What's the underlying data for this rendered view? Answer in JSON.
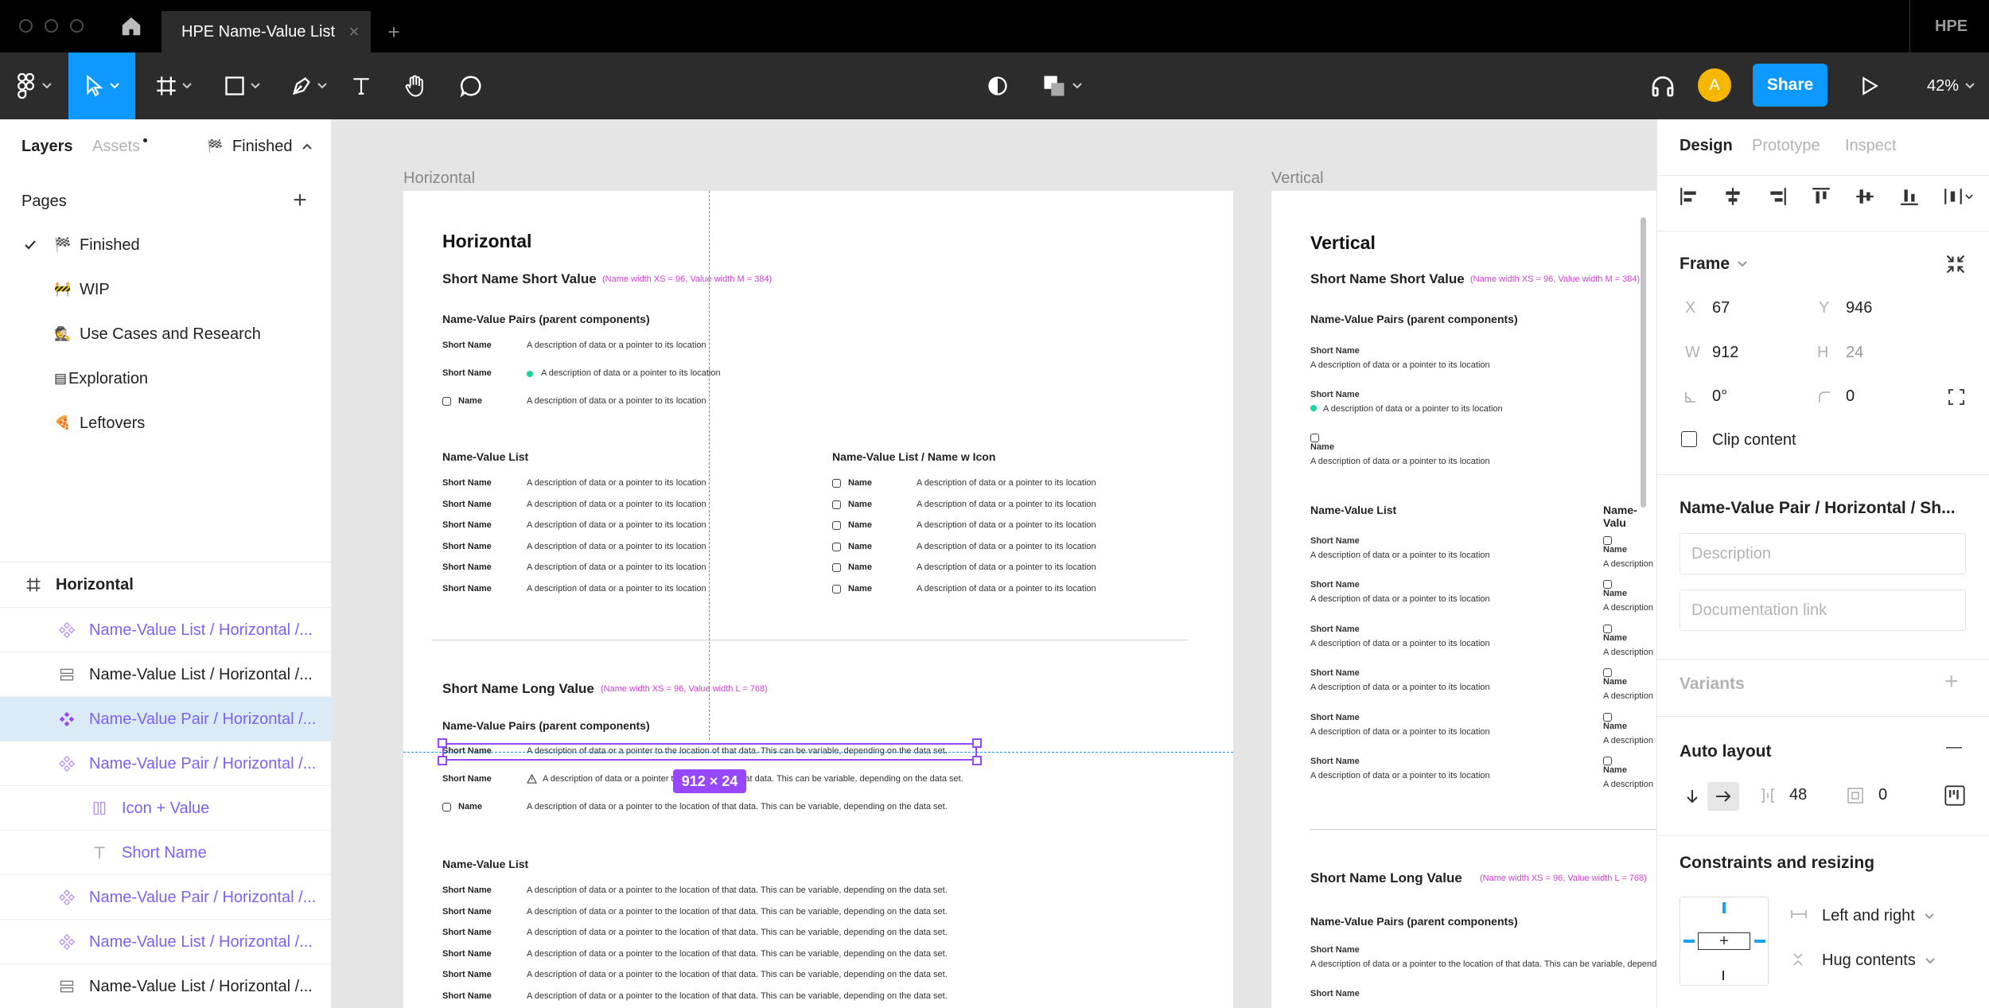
{
  "window": {
    "tab_title": "HPE Name-Value List",
    "tab_close": "×",
    "new_tab": "+",
    "brand": "HPE"
  },
  "toolbar": {
    "avatar": "A",
    "share_label": "Share",
    "zoom": "42%"
  },
  "left_panel": {
    "tabs": [
      "Layers",
      "Assets"
    ],
    "current_page_badge": "Finished",
    "pages_heading": "Pages",
    "add": "+",
    "pages": [
      {
        "label": "Finished",
        "emoji": "🏁",
        "active": true
      },
      {
        "label": "WIP",
        "emoji": "🚧",
        "active": false
      },
      {
        "label": "Use Cases and Research",
        "emoji": "🕵",
        "active": false
      },
      {
        "label": "Exploration",
        "emoji": "▤",
        "active": false
      },
      {
        "label": "Leftovers",
        "emoji": "🍕",
        "active": false
      }
    ],
    "layers": [
      {
        "label": "Horizontal",
        "icon": "frame-icon",
        "indent": 0,
        "purple": false,
        "selected": false,
        "bold": true
      },
      {
        "label": "Name-Value List / Horizontal /...",
        "icon": "component-instance-icon",
        "indent": 1,
        "purple": true,
        "selected": false
      },
      {
        "label": "Name-Value List / Horizontal /...",
        "icon": "auto-layout-vertical-icon",
        "indent": 1,
        "purple": false,
        "selected": false
      },
      {
        "label": "Name-Value Pair / Horizontal /...",
        "icon": "component-icon",
        "indent": 1,
        "purple": true,
        "selected": true
      },
      {
        "label": "Name-Value Pair / Horizontal /...",
        "icon": "component-instance-icon",
        "indent": 1,
        "purple": true,
        "selected": false
      },
      {
        "label": "Icon + Value",
        "icon": "auto-layout-horizontal-icon",
        "indent": 2,
        "purple": true,
        "selected": false
      },
      {
        "label": "Short Name",
        "icon": "text-icon",
        "indent": 2,
        "purple": true,
        "selected": false
      },
      {
        "label": "Name-Value Pair / Horizontal /...",
        "icon": "component-instance-icon",
        "indent": 1,
        "purple": true,
        "selected": false
      },
      {
        "label": "Name-Value List / Horizontal /...",
        "icon": "component-instance-icon",
        "indent": 1,
        "purple": true,
        "selected": false
      },
      {
        "label": "Name-Value List / Horizontal /...",
        "icon": "auto-layout-vertical-icon",
        "indent": 1,
        "purple": false,
        "selected": false
      }
    ]
  },
  "right_panel": {
    "tabs": [
      "Design",
      "Prototype",
      "Inspect"
    ],
    "frame_label": "Frame",
    "x_label": "X",
    "x": "67",
    "y_label": "Y",
    "y": "946",
    "w_label": "W",
    "w": "912",
    "h_label": "H",
    "h": "24",
    "rotation": "0°",
    "radius": "0",
    "clip_content": "Clip content",
    "component_name": "Name-Value Pair / Horizontal / Sh...",
    "description_placeholder": "Description",
    "doc_link_placeholder": "Documentation link",
    "variants": "Variants",
    "variants_add": "+",
    "auto_layout": "Auto layout",
    "auto_layout_remove": "—",
    "spacing": "48",
    "padding": "0",
    "constraints": "Constraints and resizing",
    "horizontal_constraint": "Left and right",
    "vertical_resizing": "Hug contents"
  },
  "canvas": {
    "frame_labels": [
      "Horizontal",
      "Vertical"
    ],
    "size_badge": "912 × 24",
    "horizontal": {
      "title": "Horizontal",
      "section1": "Short Name Short Value",
      "section1_note": "(Name width XS = 96, Value width M = 384)",
      "pairs_heading": "Name-Value Pairs (parent components)",
      "pairs": [
        {
          "name": "Short Name",
          "value": "A description of data or a pointer to its location"
        },
        {
          "name": "Short Name",
          "value": "A description of data or a pointer to its location"
        },
        {
          "name": "Name",
          "value": "A description of data or a pointer to its location"
        }
      ],
      "list_heading": "Name-Value List",
      "list_rows": [
        {
          "name": "Short Name",
          "value": "A description of data or a pointer to its location"
        },
        {
          "name": "Short Name",
          "value": "A description of data or a pointer to its location"
        },
        {
          "name": "Short Name",
          "value": "A description of data or a pointer to its location"
        },
        {
          "name": "Short Name",
          "value": "A description of data or a pointer to its location"
        },
        {
          "name": "Short Name",
          "value": "A description of data or a pointer to its location"
        },
        {
          "name": "Short Name",
          "value": "A description of data or a pointer to its location"
        }
      ],
      "icon_list_heading": "Name-Value List / Name w Icon",
      "icon_list_rows": [
        {
          "name": "Name",
          "value": "A description of data or a pointer to its location"
        },
        {
          "name": "Name",
          "value": "A description of data or a pointer to its location"
        },
        {
          "name": "Name",
          "value": "A description of data or a pointer to its location"
        },
        {
          "name": "Name",
          "value": "A description of data or a pointer to its location"
        },
        {
          "name": "Name",
          "value": "A description of data or a pointer to its location"
        },
        {
          "name": "Name",
          "value": "A description of data or a pointer to its location"
        }
      ],
      "section2": "Short Name Long Value",
      "section2_note": "(Name width XS = 96, Value width L = 768)",
      "pairs2_heading": "Name-Value Pairs (parent components)",
      "pairs2": [
        {
          "name": "Short Name",
          "value": "A description of data or a pointer to the location of that data. This can be variable, depending on the data set."
        },
        {
          "name": "Short Name",
          "value": "A description of data or a pointer to the location of that data. This can be variable, depending on the data set."
        },
        {
          "name": "Name",
          "value": "A description of data or a pointer to the location of that data. This can be variable, depending on the data set."
        }
      ],
      "list2_heading": "Name-Value List",
      "list2_rows": [
        {
          "name": "Short Name",
          "value": "A description of data or a pointer to the location of that data. This can be variable, depending on the data set."
        },
        {
          "name": "Short Name",
          "value": "A description of data or a pointer to the location of that data. This can be variable, depending on the data set."
        },
        {
          "name": "Short Name",
          "value": "A description of data or a pointer to the location of that data. This can be variable, depending on the data set."
        },
        {
          "name": "Short Name",
          "value": "A description of data or a pointer to the location of that data. This can be variable, depending on the data set."
        },
        {
          "name": "Short Name",
          "value": "A description of data or a pointer to the location of that data. This can be variable, depending on the data set."
        },
        {
          "name": "Short Name",
          "value": "A description of data or a pointer to the location of that data. This can be variable, depending on the data set."
        }
      ]
    },
    "vertical": {
      "title": "Vertical",
      "section1": "Short Name Short Value",
      "section1_note": "(Name width XS = 96, Value width M = 384)",
      "pairs_heading": "Name-Value Pairs (parent components)",
      "pairs": [
        {
          "name": "Short Name",
          "value": "A description of data or a pointer to its location"
        },
        {
          "name": "Short Name",
          "value": "A description of data or a pointer to its location"
        },
        {
          "name": "Name",
          "value": "A description of data or a pointer to its location"
        }
      ],
      "list_heading": "Name-Value List",
      "list_rows": [
        {
          "name": "Short Name",
          "value": "A description of data or a pointer to its location"
        },
        {
          "name": "Short Name",
          "value": "A description of data or a pointer to its location"
        },
        {
          "name": "Short Name",
          "value": "A description of data or a pointer to its location"
        },
        {
          "name": "Short Name",
          "value": "A description of data or a pointer to its location"
        },
        {
          "name": "Short Name",
          "value": "A description of data or a pointer to its location"
        },
        {
          "name": "Short Name",
          "value": "A description of data or a pointer to its location"
        }
      ],
      "icon_list_heading": "Name-Valu",
      "icon_list_rows": [
        {
          "name": "Name",
          "value": "A description"
        },
        {
          "name": "Name",
          "value": "A description"
        },
        {
          "name": "Name",
          "value": "A description"
        },
        {
          "name": "Name",
          "value": "A description"
        },
        {
          "name": "Name",
          "value": "A description"
        },
        {
          "name": "Name",
          "value": "A description"
        }
      ],
      "section2": "Short Name Long Value",
      "section2_note": "(Name width XS = 96, Value width L = 768)",
      "pairs2_heading": "Name-Value Pairs (parent components)",
      "pairs2": [
        {
          "name": "Short Name",
          "value": "A description of data or a pointer to the location of that data. This can be variable, depending on the data set."
        },
        {
          "name": "Short Name",
          "value": ""
        }
      ]
    }
  }
}
